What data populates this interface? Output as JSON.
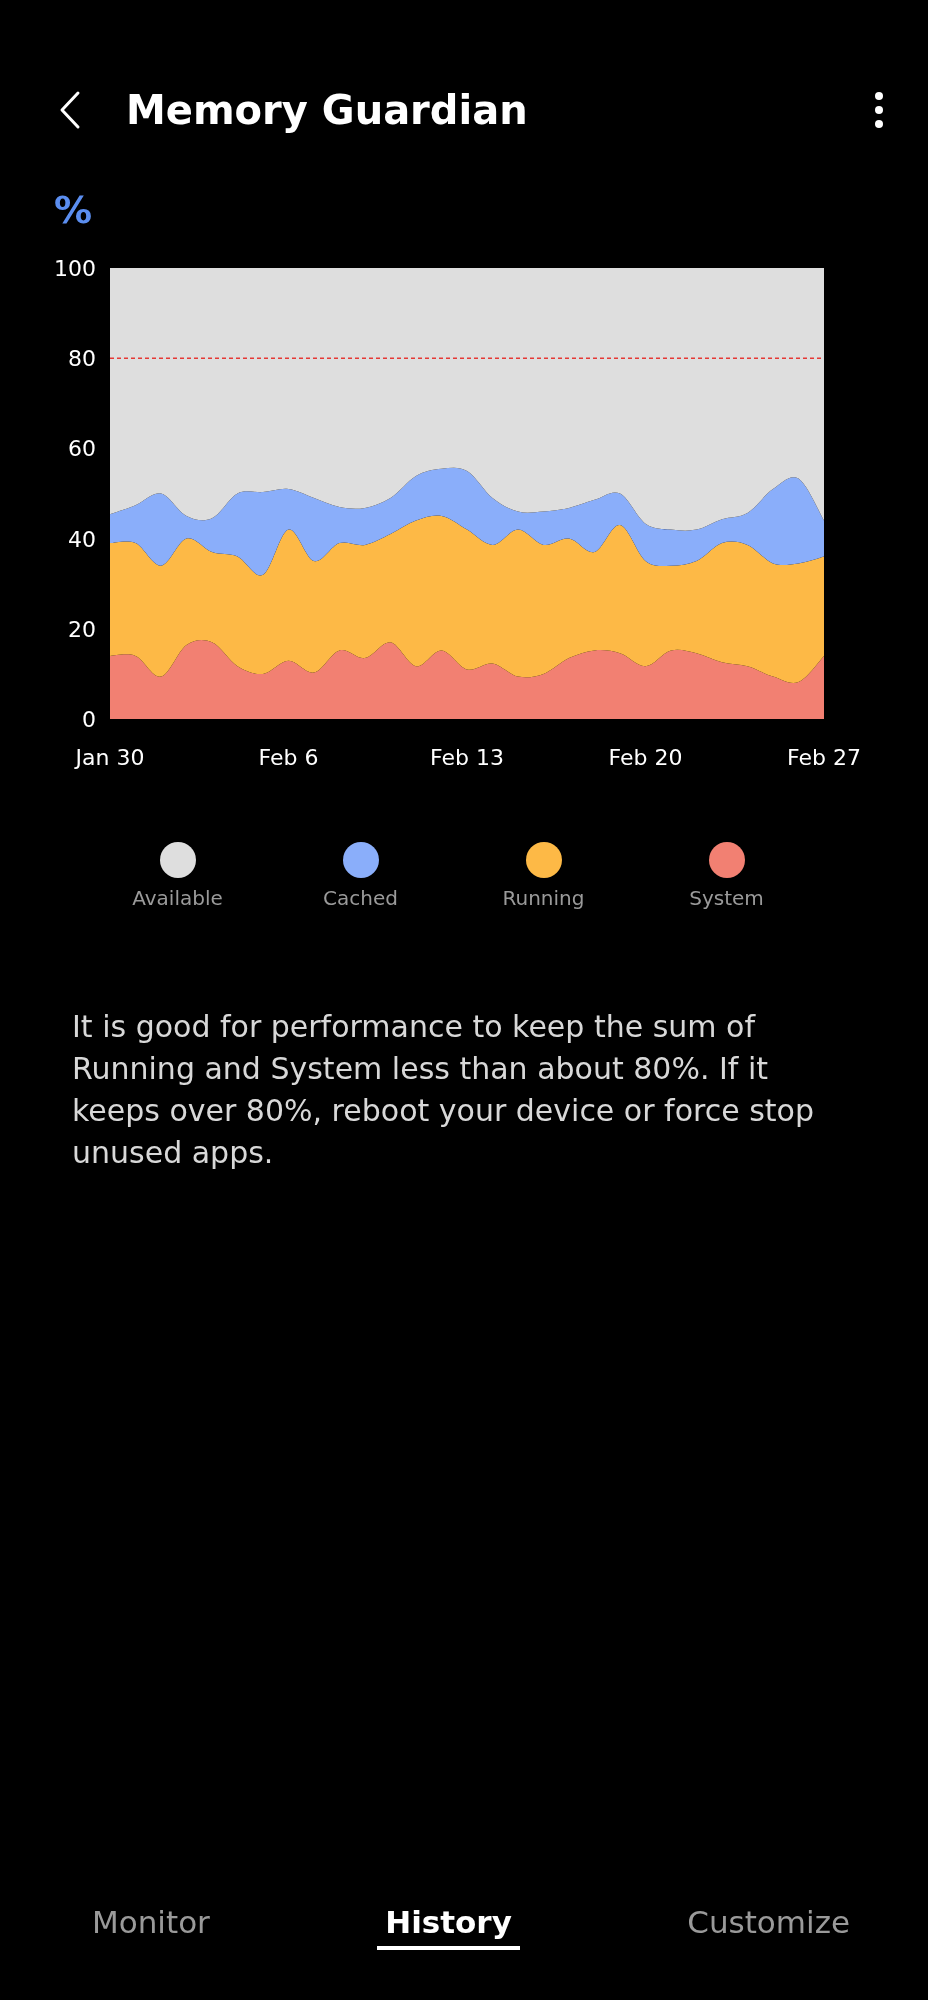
{
  "header": {
    "title": "Memory Guardian"
  },
  "chart": {
    "unit": "%",
    "chart_data": {
      "type": "area",
      "stacked": true,
      "categories": [
        "Jan 30",
        null,
        null,
        null,
        null,
        null,
        null,
        "Feb 6",
        null,
        null,
        null,
        null,
        null,
        null,
        "Feb 13",
        null,
        null,
        null,
        null,
        null,
        null,
        "Feb 20",
        null,
        null,
        null,
        null,
        null,
        null,
        "Feb 27"
      ],
      "ylim": [
        0,
        100
      ],
      "yticks": [
        0,
        20,
        40,
        60,
        80,
        100
      ],
      "series": [
        {
          "name": "Available",
          "color": "#dedede",
          "values": [
            54.6,
            52.6,
            50,
            55,
            55.5,
            50,
            49.7,
            49,
            51,
            53,
            53.2,
            51,
            46.1,
            44.5,
            45,
            51,
            54,
            54,
            53.2,
            51.4,
            50,
            56.7,
            58,
            58,
            55.7,
            54.3,
            49,
            46.7,
            56
          ]
        },
        {
          "name": "Cached",
          "color": "#8aaefa",
          "values": [
            6.4,
            8.4,
            16,
            5,
            7.5,
            14,
            18.3,
            9,
            14,
            8,
            8.2,
            8,
            9.9,
            10.5,
            13,
            10.4,
            4,
            7.4,
            6.8,
            11.6,
            7,
            8.3,
            8,
            7,
            5.3,
            7.1,
            16.5,
            18.8,
            8
          ]
        },
        {
          "name": "Running",
          "color": "#fdb946",
          "values": [
            25,
            25,
            24.6,
            23.6,
            20,
            24.3,
            22,
            29.1,
            24.7,
            23.8,
            25.1,
            24,
            32.3,
            29.8,
            31,
            26.3,
            32.6,
            28.6,
            26.5,
            21.8,
            28.4,
            23.3,
            18.8,
            20.4,
            26.4,
            26.9,
            25.1,
            26.3,
            22
          ]
        },
        {
          "name": "System",
          "color": "#f28072",
          "values": [
            14,
            14,
            9.4,
            16.4,
            17,
            11.7,
            10,
            12.9,
            10.3,
            15.2,
            13.5,
            17,
            11.7,
            15.2,
            11,
            12.3,
            9.4,
            10,
            13.5,
            15.2,
            14.6,
            11.7,
            15.2,
            14.6,
            12.6,
            11.7,
            9.4,
            8.2,
            14
          ]
        }
      ],
      "ref_lines": [
        {
          "axis": "y",
          "value": 80,
          "color": "#e53935"
        }
      ]
    }
  },
  "note": "It is good for performance to keep the sum of Running and System less than about 80%. If it keeps over 80%, reboot your device or force stop unused apps.",
  "tabs": [
    {
      "label": "Monitor",
      "selected": false
    },
    {
      "label": "History",
      "selected": true
    },
    {
      "label": "Customize",
      "selected": false
    }
  ]
}
